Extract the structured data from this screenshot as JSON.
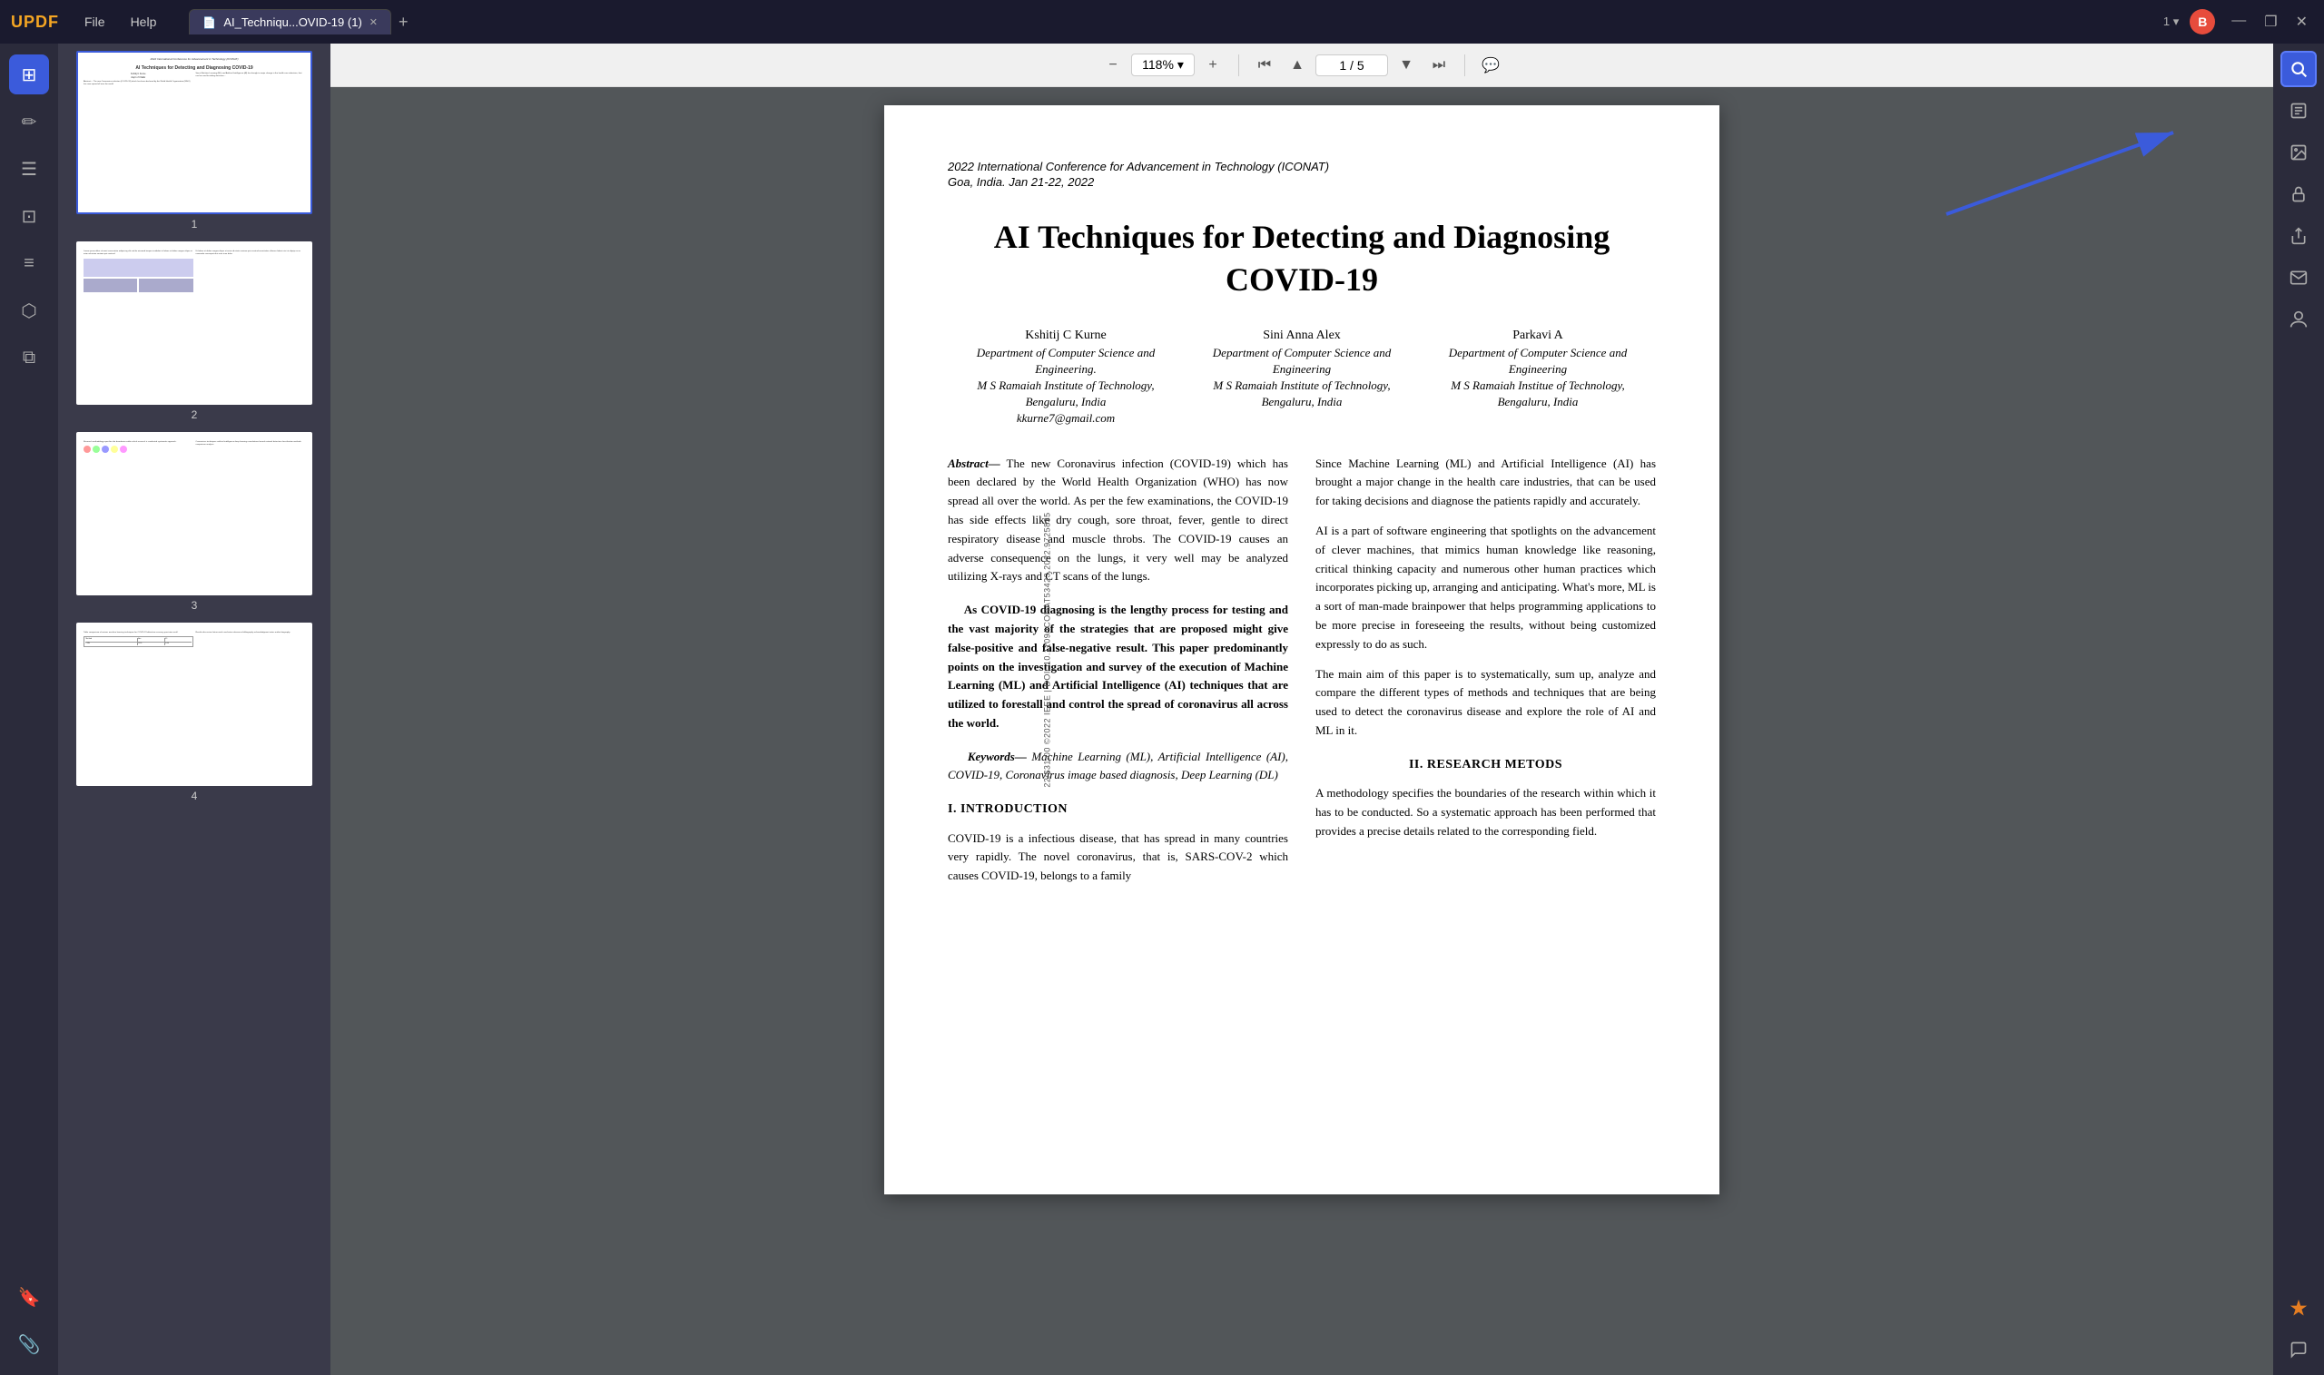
{
  "app": {
    "logo": "UPDF",
    "menus": [
      "File",
      "Help"
    ],
    "tab_label": "AI_Techniqu...OVID-19 (1)",
    "tab_add": "+",
    "version": "1",
    "user_initial": "B",
    "win_minimize": "—",
    "win_restore": "❐",
    "win_close": "✕"
  },
  "toolbar": {
    "zoom_out": "−",
    "zoom_level": "118%",
    "zoom_dropdown": "▾",
    "zoom_in": "+",
    "nav_first": "⏮",
    "nav_prev": "▲",
    "page_current": "1",
    "page_separator": "/",
    "page_total": "5",
    "nav_next": "▼",
    "nav_last": "⏭",
    "comment": "💬"
  },
  "sidebar": {
    "icons": [
      {
        "name": "grid-view",
        "glyph": "⊞",
        "active": true
      },
      {
        "name": "edit",
        "glyph": "✏",
        "active": false
      },
      {
        "name": "list",
        "glyph": "☰",
        "active": false
      },
      {
        "name": "layout",
        "glyph": "⊡",
        "active": false
      },
      {
        "name": "chart",
        "glyph": "≡",
        "active": false
      },
      {
        "name": "stamp",
        "glyph": "⬡",
        "active": false
      },
      {
        "name": "layers",
        "glyph": "⧉",
        "active": false
      },
      {
        "name": "bookmark",
        "glyph": "🔖",
        "active": false
      },
      {
        "name": "attachment",
        "glyph": "📎",
        "active": false
      }
    ]
  },
  "right_sidebar": {
    "icons": [
      {
        "name": "search",
        "glyph": "🔍",
        "active_highlight": true
      },
      {
        "name": "ocr",
        "glyph": "📝",
        "active": false
      },
      {
        "name": "image",
        "glyph": "🖼",
        "active": false
      },
      {
        "name": "lock",
        "glyph": "🔒",
        "active": false
      },
      {
        "name": "share",
        "glyph": "↑",
        "active": false
      },
      {
        "name": "mail",
        "glyph": "✉",
        "active": false
      },
      {
        "name": "stamp2",
        "glyph": "🔏",
        "active": false
      },
      {
        "name": "ai-assistant",
        "glyph": "✦",
        "active": false,
        "bottom": true
      },
      {
        "name": "comment2",
        "glyph": "💬",
        "active": false
      }
    ]
  },
  "thumbnails": [
    {
      "page_num": "1",
      "selected": true
    },
    {
      "page_num": "2",
      "selected": false
    },
    {
      "page_num": "3",
      "selected": false
    },
    {
      "page_num": "4",
      "selected": false
    }
  ],
  "paper": {
    "conference": "2022 International Conference for Advancement in Technology (ICONAT)",
    "location": "Goa, India. Jan 21-22, 2022",
    "title": "AI Techniques for Detecting and Diagnosing COVID-19",
    "authors": [
      {
        "name": "Kshitij C Kurne",
        "dept": "Department of Computer Science and Engineering.",
        "institute": "M S Ramaiah Institute of Technology,",
        "city": "Bengaluru, India",
        "email": "kkurne7@gmail.com"
      },
      {
        "name": "Sini Anna Alex",
        "dept": "Department of Computer Science and Engineering",
        "institute": "M S Ramaiah Institute of Technology,",
        "city": "Bengaluru, India",
        "email": ""
      },
      {
        "name": "Parkavi A",
        "dept": "Department of Computer Science and Engineering",
        "institute": "M S Ramaiah Institue of Technology,",
        "city": "Bengaluru, India",
        "email": ""
      }
    ],
    "abstract_label": "Abstract—",
    "abstract_text": " The new Coronavirus infection (COVID-19) which has been declared by the World Health Organization (WHO) has now spread all over the world. As per the few examinations, the COVID-19 has side effects like dry cough, sore throat, fever, gentle to direct respiratory disease and muscle throbs. The COVID-19 causes an adverse consequence on the lungs, it very well may be analyzed utilizing X-rays and CT scans of the lungs.",
    "abstract_para2": "As COVID-19 diagnosing is the lengthy process for testing and the vast majority of the strategies that are proposed might give false-positive and false-negative result. This paper predominantly points on the investigation and survey of the execution of Machine Learning (ML) and Artificial Intelligence (AI) techniques that are utilized to forestall and control the spread of coronavirus all across the world.",
    "keywords_label": "Keywords—",
    "keywords_text": "Machine Learning (ML), Artificial Intelligence (AI), COVID-19, Coronavirus image based diagnosis, Deep Learning (DL)",
    "section1_heading": "I.    Introduction",
    "intro_text": "COVID-19 is a infectious disease, that has spread in many countries very rapidly. The novel coronavirus, that is, SARS-COV-2 which causes COVID-19, belongs to a family",
    "right_col_para1": "Since Machine Learning (ML) and Artificial Intelligence (AI) has brought a major change in the health care industries, that can be used for taking decisions and diagnose the patients rapidly and accurately.",
    "right_col_para2": "AI is a part of software engineering that spotlights on the advancement of clever machines, that mimics human knowledge like reasoning, critical thinking capacity and numerous other human practices which incorporates picking up, arranging and anticipating. What's more, ML is a sort of man-made brainpower that helps programming applications to be more precise in foreseeing the results, without being customized expressly to do as such.",
    "right_col_para3": "The main aim of this paper is to systematically, sum up, analyze and compare the different types of methods and techniques that are being used to detect the coronavirus disease and explore the role of AI and ML in it.",
    "section2_heading": "II.    RESEARCH METODS",
    "section2_text": "A methodology specifies the boundaries of the research within which it has to be conducted. So a systematic approach has been performed that provides a precise details related to the corresponding field.",
    "doi_text": "22/$31.00 ©2022 IEEE | DOI: 10.1109/ICONAT53423.2022.9725835"
  }
}
